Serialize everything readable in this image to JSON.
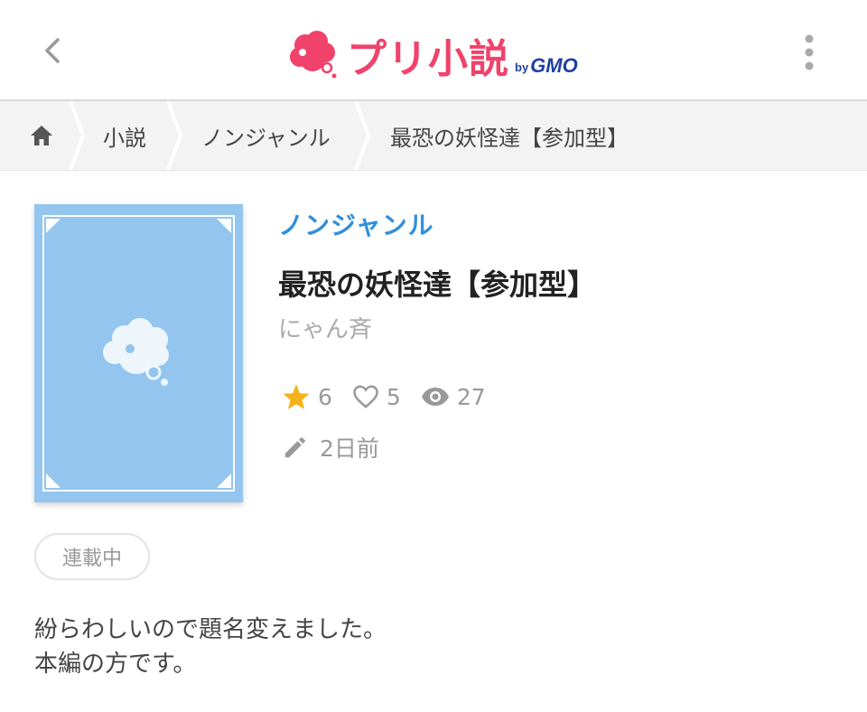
{
  "header": {
    "logo_text": "プリ小説",
    "logo_by": "by",
    "logo_gmo": "GMO"
  },
  "breadcrumb": {
    "items": [
      "小説",
      "ノンジャンル",
      "最恐の妖怪達【参加型】"
    ]
  },
  "novel": {
    "genre": "ノンジャンル",
    "title": "最恐の妖怪達【参加型】",
    "author": "にゃん斉",
    "stars": "6",
    "likes": "5",
    "views": "27",
    "updated": "2日前",
    "status": "連載中",
    "description": [
      "紛らわしいので題名変えました。",
      "本編の方です。"
    ]
  },
  "colors": {
    "brand": "#f0426b",
    "genre": "#2f8fdc",
    "cover": "#93c5ee",
    "star": "#f5b21a"
  }
}
